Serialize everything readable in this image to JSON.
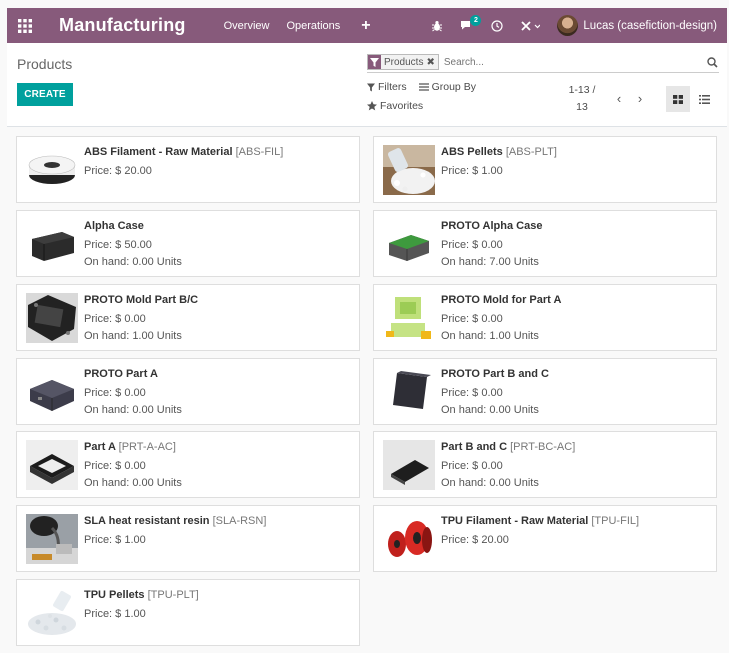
{
  "nav": {
    "app_name": "Manufacturing",
    "menus": [
      "Overview",
      "Operations"
    ],
    "plus": "+",
    "chat_badge": "2",
    "user": "Lucas (casefiction-design)",
    "brand_color": "#875a7b"
  },
  "control_panel": {
    "title": "Products",
    "create_label": "CREATE",
    "search_facet": "Products",
    "search_placeholder": "Search...",
    "filters_label": "Filters",
    "group_by_label": "Group By",
    "favorites_label": "Favorites",
    "pager": {
      "range": "1-13 /",
      "total": "13"
    },
    "accent_color": "#00a09d"
  },
  "products": [
    {
      "name": "ABS Filament - Raw Material",
      "ref": "[ABS-FIL]",
      "price": "Price: $ 20.00",
      "onhand": "",
      "image": "filament-spool"
    },
    {
      "name": "ABS Pellets",
      "ref": "[ABS-PLT]",
      "price": "Price: $ 1.00",
      "onhand": "",
      "image": "white-pellets"
    },
    {
      "name": "Alpha Case",
      "ref": "",
      "price": "Price: $ 50.00",
      "onhand": "On hand: 0.00 Units",
      "image": "black-case"
    },
    {
      "name": "PROTO Alpha Case",
      "ref": "",
      "price": "Price: $ 0.00",
      "onhand": "On hand: 7.00 Units",
      "image": "green-case"
    },
    {
      "name": "PROTO Mold Part B/C",
      "ref": "",
      "price": "Price: $ 0.00",
      "onhand": "On hand: 1.00 Units",
      "image": "black-mold"
    },
    {
      "name": "PROTO Mold for Part A",
      "ref": "",
      "price": "Price: $ 0.00",
      "onhand": "On hand: 1.00 Units",
      "image": "green-mold"
    },
    {
      "name": "PROTO Part A",
      "ref": "",
      "price": "Price: $ 0.00",
      "onhand": "On hand: 0.00 Units",
      "image": "dark-box"
    },
    {
      "name": "PROTO Part B and C",
      "ref": "",
      "price": "Price: $ 0.00",
      "onhand": "On hand: 0.00 Units",
      "image": "dark-panel"
    },
    {
      "name": "Part A",
      "ref": "[PRT-A-AC]",
      "price": "Price: $ 0.00",
      "onhand": "On hand: 0.00 Units",
      "image": "black-frame"
    },
    {
      "name": "Part B and C",
      "ref": "[PRT-BC-AC]",
      "price": "Price: $ 0.00",
      "onhand": "On hand: 0.00 Units",
      "image": "black-plate"
    },
    {
      "name": "SLA heat resistant resin",
      "ref": "[SLA-RSN]",
      "price": "Price: $ 1.00",
      "onhand": "",
      "image": "resin-pour"
    },
    {
      "name": "TPU Filament - Raw Material",
      "ref": "[TPU-FIL]",
      "price": "Price: $ 20.00",
      "onhand": "",
      "image": "red-spools"
    },
    {
      "name": "TPU Pellets",
      "ref": "[TPU-PLT]",
      "price": "Price: $ 1.00",
      "onhand": "",
      "image": "clear-pellets"
    }
  ]
}
